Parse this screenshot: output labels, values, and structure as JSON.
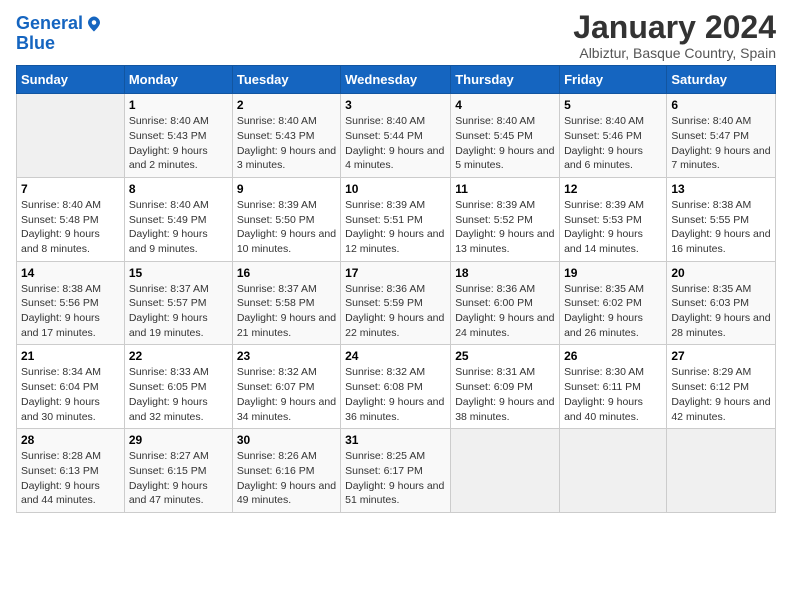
{
  "logo": {
    "line1": "General",
    "line2": "Blue"
  },
  "title": "January 2024",
  "subtitle": "Albiztur, Basque Country, Spain",
  "headers": [
    "Sunday",
    "Monday",
    "Tuesday",
    "Wednesday",
    "Thursday",
    "Friday",
    "Saturday"
  ],
  "weeks": [
    [
      {
        "day": "",
        "sunrise": "",
        "sunset": "",
        "daylight": ""
      },
      {
        "day": "1",
        "sunrise": "Sunrise: 8:40 AM",
        "sunset": "Sunset: 5:43 PM",
        "daylight": "Daylight: 9 hours and 2 minutes."
      },
      {
        "day": "2",
        "sunrise": "Sunrise: 8:40 AM",
        "sunset": "Sunset: 5:43 PM",
        "daylight": "Daylight: 9 hours and 3 minutes."
      },
      {
        "day": "3",
        "sunrise": "Sunrise: 8:40 AM",
        "sunset": "Sunset: 5:44 PM",
        "daylight": "Daylight: 9 hours and 4 minutes."
      },
      {
        "day": "4",
        "sunrise": "Sunrise: 8:40 AM",
        "sunset": "Sunset: 5:45 PM",
        "daylight": "Daylight: 9 hours and 5 minutes."
      },
      {
        "day": "5",
        "sunrise": "Sunrise: 8:40 AM",
        "sunset": "Sunset: 5:46 PM",
        "daylight": "Daylight: 9 hours and 6 minutes."
      },
      {
        "day": "6",
        "sunrise": "Sunrise: 8:40 AM",
        "sunset": "Sunset: 5:47 PM",
        "daylight": "Daylight: 9 hours and 7 minutes."
      }
    ],
    [
      {
        "day": "7",
        "sunrise": "Sunrise: 8:40 AM",
        "sunset": "Sunset: 5:48 PM",
        "daylight": "Daylight: 9 hours and 8 minutes."
      },
      {
        "day": "8",
        "sunrise": "Sunrise: 8:40 AM",
        "sunset": "Sunset: 5:49 PM",
        "daylight": "Daylight: 9 hours and 9 minutes."
      },
      {
        "day": "9",
        "sunrise": "Sunrise: 8:39 AM",
        "sunset": "Sunset: 5:50 PM",
        "daylight": "Daylight: 9 hours and 10 minutes."
      },
      {
        "day": "10",
        "sunrise": "Sunrise: 8:39 AM",
        "sunset": "Sunset: 5:51 PM",
        "daylight": "Daylight: 9 hours and 12 minutes."
      },
      {
        "day": "11",
        "sunrise": "Sunrise: 8:39 AM",
        "sunset": "Sunset: 5:52 PM",
        "daylight": "Daylight: 9 hours and 13 minutes."
      },
      {
        "day": "12",
        "sunrise": "Sunrise: 8:39 AM",
        "sunset": "Sunset: 5:53 PM",
        "daylight": "Daylight: 9 hours and 14 minutes."
      },
      {
        "day": "13",
        "sunrise": "Sunrise: 8:38 AM",
        "sunset": "Sunset: 5:55 PM",
        "daylight": "Daylight: 9 hours and 16 minutes."
      }
    ],
    [
      {
        "day": "14",
        "sunrise": "Sunrise: 8:38 AM",
        "sunset": "Sunset: 5:56 PM",
        "daylight": "Daylight: 9 hours and 17 minutes."
      },
      {
        "day": "15",
        "sunrise": "Sunrise: 8:37 AM",
        "sunset": "Sunset: 5:57 PM",
        "daylight": "Daylight: 9 hours and 19 minutes."
      },
      {
        "day": "16",
        "sunrise": "Sunrise: 8:37 AM",
        "sunset": "Sunset: 5:58 PM",
        "daylight": "Daylight: 9 hours and 21 minutes."
      },
      {
        "day": "17",
        "sunrise": "Sunrise: 8:36 AM",
        "sunset": "Sunset: 5:59 PM",
        "daylight": "Daylight: 9 hours and 22 minutes."
      },
      {
        "day": "18",
        "sunrise": "Sunrise: 8:36 AM",
        "sunset": "Sunset: 6:00 PM",
        "daylight": "Daylight: 9 hours and 24 minutes."
      },
      {
        "day": "19",
        "sunrise": "Sunrise: 8:35 AM",
        "sunset": "Sunset: 6:02 PM",
        "daylight": "Daylight: 9 hours and 26 minutes."
      },
      {
        "day": "20",
        "sunrise": "Sunrise: 8:35 AM",
        "sunset": "Sunset: 6:03 PM",
        "daylight": "Daylight: 9 hours and 28 minutes."
      }
    ],
    [
      {
        "day": "21",
        "sunrise": "Sunrise: 8:34 AM",
        "sunset": "Sunset: 6:04 PM",
        "daylight": "Daylight: 9 hours and 30 minutes."
      },
      {
        "day": "22",
        "sunrise": "Sunrise: 8:33 AM",
        "sunset": "Sunset: 6:05 PM",
        "daylight": "Daylight: 9 hours and 32 minutes."
      },
      {
        "day": "23",
        "sunrise": "Sunrise: 8:32 AM",
        "sunset": "Sunset: 6:07 PM",
        "daylight": "Daylight: 9 hours and 34 minutes."
      },
      {
        "day": "24",
        "sunrise": "Sunrise: 8:32 AM",
        "sunset": "Sunset: 6:08 PM",
        "daylight": "Daylight: 9 hours and 36 minutes."
      },
      {
        "day": "25",
        "sunrise": "Sunrise: 8:31 AM",
        "sunset": "Sunset: 6:09 PM",
        "daylight": "Daylight: 9 hours and 38 minutes."
      },
      {
        "day": "26",
        "sunrise": "Sunrise: 8:30 AM",
        "sunset": "Sunset: 6:11 PM",
        "daylight": "Daylight: 9 hours and 40 minutes."
      },
      {
        "day": "27",
        "sunrise": "Sunrise: 8:29 AM",
        "sunset": "Sunset: 6:12 PM",
        "daylight": "Daylight: 9 hours and 42 minutes."
      }
    ],
    [
      {
        "day": "28",
        "sunrise": "Sunrise: 8:28 AM",
        "sunset": "Sunset: 6:13 PM",
        "daylight": "Daylight: 9 hours and 44 minutes."
      },
      {
        "day": "29",
        "sunrise": "Sunrise: 8:27 AM",
        "sunset": "Sunset: 6:15 PM",
        "daylight": "Daylight: 9 hours and 47 minutes."
      },
      {
        "day": "30",
        "sunrise": "Sunrise: 8:26 AM",
        "sunset": "Sunset: 6:16 PM",
        "daylight": "Daylight: 9 hours and 49 minutes."
      },
      {
        "day": "31",
        "sunrise": "Sunrise: 8:25 AM",
        "sunset": "Sunset: 6:17 PM",
        "daylight": "Daylight: 9 hours and 51 minutes."
      },
      {
        "day": "",
        "sunrise": "",
        "sunset": "",
        "daylight": ""
      },
      {
        "day": "",
        "sunrise": "",
        "sunset": "",
        "daylight": ""
      },
      {
        "day": "",
        "sunrise": "",
        "sunset": "",
        "daylight": ""
      }
    ]
  ]
}
